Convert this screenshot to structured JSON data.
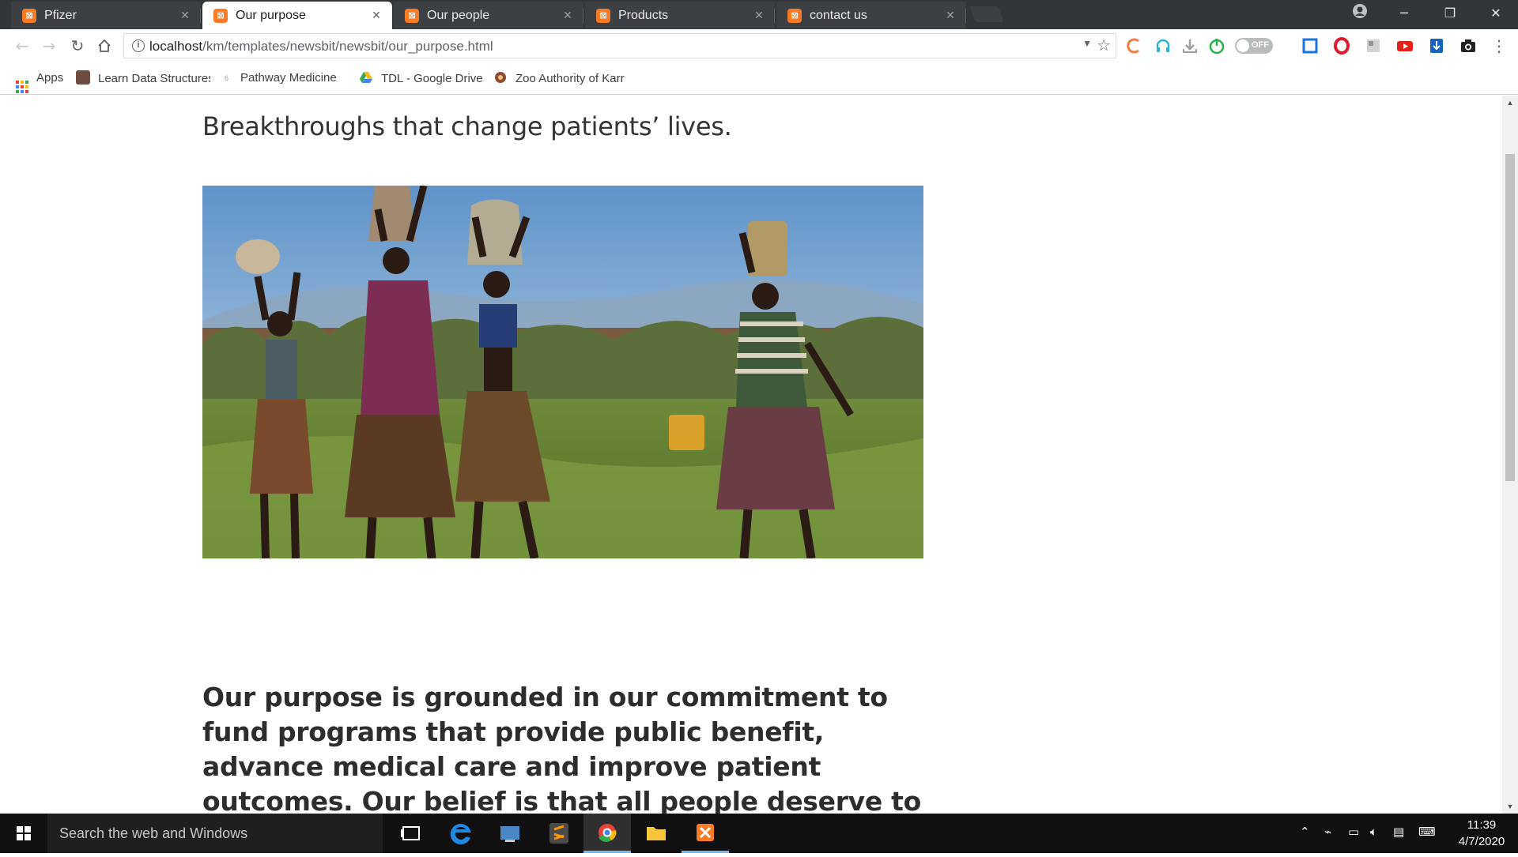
{
  "tabs": [
    {
      "title": "Pfizer",
      "active": false
    },
    {
      "title": "Our purpose",
      "active": true
    },
    {
      "title": "Our people",
      "active": false
    },
    {
      "title": "Products",
      "active": false
    },
    {
      "title": "contact us",
      "active": false
    }
  ],
  "favicon_glyph": "⊠",
  "omnibox": {
    "url_host": "localhost",
    "url_path": "/km/templates/newsbit/newsbit/our_purpose.html"
  },
  "extensions": [
    "orange-c-icon",
    "headphones-icon",
    "download-icon",
    "power-icon",
    "toggle-off-icon",
    "blue-square-icon",
    "opera-icon",
    "photo-icon",
    "youtube-icon",
    "download-arrow-icon",
    "camera-icon"
  ],
  "toggle_label": "OFF",
  "bookmarks": [
    {
      "label": "Apps",
      "icon": "apps-icon"
    },
    {
      "label": "Learn Data Structures",
      "icon": "cc-icon"
    },
    {
      "label": "Pathway Medicine",
      "icon": "pathway-icon"
    },
    {
      "label": "TDL - Google Drive",
      "icon": "drive-icon"
    },
    {
      "label": "Zoo Authority of Karr",
      "icon": "zoo-icon"
    }
  ],
  "page": {
    "tagline": "Breakthroughs that change patients’ lives.",
    "purpose_text": "Our purpose is grounded in our commitment to fund programs that provide public benefit, advance medical care and improve patient outcomes. Our belief is that all people deserve to live healthy lives. This drives our"
  },
  "taskbar": {
    "search_placeholder": "Search the web and Windows",
    "time": "11:39",
    "date": "4/7/2020"
  },
  "colors": {
    "tab_strip": "#323639",
    "favicon": "#fb7a24",
    "taskbar": "#101010",
    "accent": "#76b9ed"
  }
}
